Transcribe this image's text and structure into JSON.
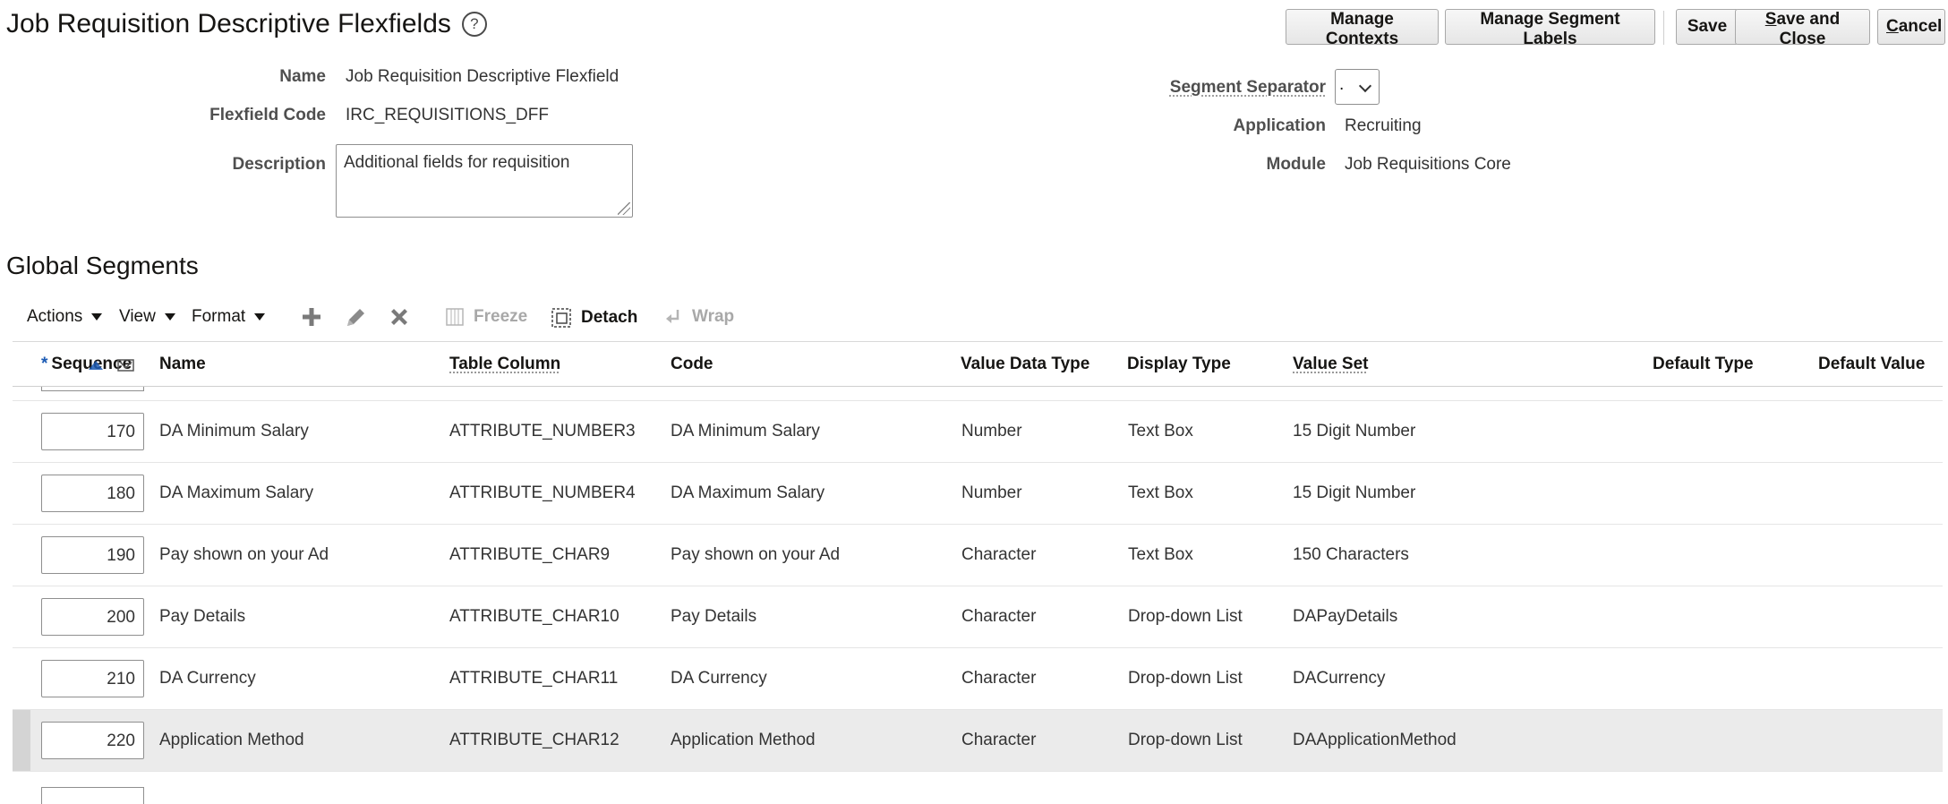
{
  "page": {
    "title": "Job Requisition Descriptive Flexfields",
    "help_icon": "question-circle-icon"
  },
  "toolbar": {
    "manage_contexts": "Manage Contexts",
    "manage_segment_labels": "Manage Segment Labels",
    "save": "Save",
    "save_and_close_key": "S",
    "save_and_close_rest": "ave and Close",
    "cancel_key": "C",
    "cancel_rest": "ancel"
  },
  "form": {
    "name_label": "Name",
    "name_value": "Job Requisition Descriptive Flexfield",
    "code_label": "Flexfield Code",
    "code_value": "IRC_REQUISITIONS_DFF",
    "description_label": "Description",
    "description_value": "Additional fields for requisition",
    "separator_label": "Segment Separator",
    "separator_value": ".",
    "application_label": "Application",
    "application_value": "Recruiting",
    "module_label": "Module",
    "module_value": "Job Requisitions Core"
  },
  "segments": {
    "title": "Global Segments",
    "actions": "Actions",
    "view": "View",
    "format": "Format",
    "freeze": "Freeze",
    "detach": "Detach",
    "wrap": "Wrap",
    "columns": {
      "required_marker": "*",
      "sequence": "Sequence",
      "name": "Name",
      "table_column": "Table Column",
      "code": "Code",
      "value_data_type": "Value Data Type",
      "display_type": "Display Type",
      "value_set": "Value Set",
      "default_type": "Default Type",
      "default_value": "Default Value"
    },
    "rows": [
      {
        "sequence": "170",
        "name": "DA Minimum Salary",
        "table_column": "ATTRIBUTE_NUMBER3",
        "code": "DA Minimum Salary",
        "value_data_type": "Number",
        "display_type": "Text Box",
        "value_set": "15 Digit Number"
      },
      {
        "sequence": "180",
        "name": "DA Maximum Salary",
        "table_column": "ATTRIBUTE_NUMBER4",
        "code": "DA Maximum Salary",
        "value_data_type": "Number",
        "display_type": "Text Box",
        "value_set": "15 Digit Number"
      },
      {
        "sequence": "190",
        "name": "Pay shown on your Ad",
        "table_column": "ATTRIBUTE_CHAR9",
        "code": "Pay shown on your Ad",
        "value_data_type": "Character",
        "display_type": "Text Box",
        "value_set": "150 Characters"
      },
      {
        "sequence": "200",
        "name": "Pay Details",
        "table_column": "ATTRIBUTE_CHAR10",
        "code": "Pay Details",
        "value_data_type": "Character",
        "display_type": "Drop-down List",
        "value_set": "DAPayDetails"
      },
      {
        "sequence": "210",
        "name": "DA Currency",
        "table_column": "ATTRIBUTE_CHAR11",
        "code": "DA Currency",
        "value_data_type": "Character",
        "display_type": "Drop-down List",
        "value_set": "DACurrency"
      },
      {
        "sequence": "220",
        "name": "Application Method",
        "table_column": "ATTRIBUTE_CHAR12",
        "code": "Application Method",
        "value_data_type": "Character",
        "display_type": "Drop-down List",
        "value_set": "DAApplicationMethod",
        "selected": true
      }
    ]
  }
}
